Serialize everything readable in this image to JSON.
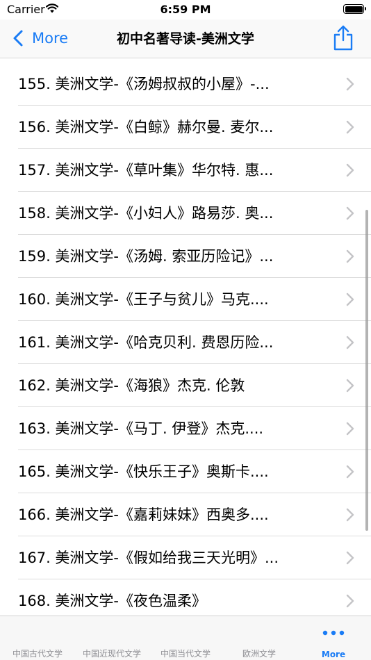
{
  "status": {
    "carrier": "Carrier",
    "time": "6:59 PM"
  },
  "nav": {
    "back_label": "More",
    "title": "初中名著导读-美洲文学"
  },
  "list": {
    "items": [
      "155. 美洲文学-《汤姆叔叔的小屋》-...",
      "156. 美洲文学-《白鲸》赫尔曼. 麦尔...",
      "157. 美洲文学-《草叶集》华尔特. 惠...",
      "158. 美洲文学-《小妇人》路易莎. 奥...",
      "159. 美洲文学-《汤姆. 索亚历险记》...",
      "160. 美洲文学-《王子与贫儿》马克....",
      "161. 美洲文学-《哈克贝利. 费恩历险...",
      "162. 美洲文学-《海狼》杰克. 伦敦",
      "163. 美洲文学-《马丁. 伊登》杰克....",
      "165. 美洲文学-《快乐王子》奥斯卡....",
      "166. 美洲文学-《嘉莉妹妹》西奥多....",
      "167. 美洲文学-《假如给我三天光明》...",
      "168. 美洲文学-《夜色温柔》"
    ]
  },
  "tabs": [
    {
      "label": "中国古代文学",
      "active": false
    },
    {
      "label": "中国近现代文学",
      "active": false
    },
    {
      "label": "中国当代文学",
      "active": false
    },
    {
      "label": "欧洲文学",
      "active": false
    },
    {
      "label": "More",
      "active": true,
      "icon": "more-dots-icon"
    }
  ],
  "colors": {
    "accent": "#1a7cf5",
    "tab_inactive": "#8e8e93"
  }
}
